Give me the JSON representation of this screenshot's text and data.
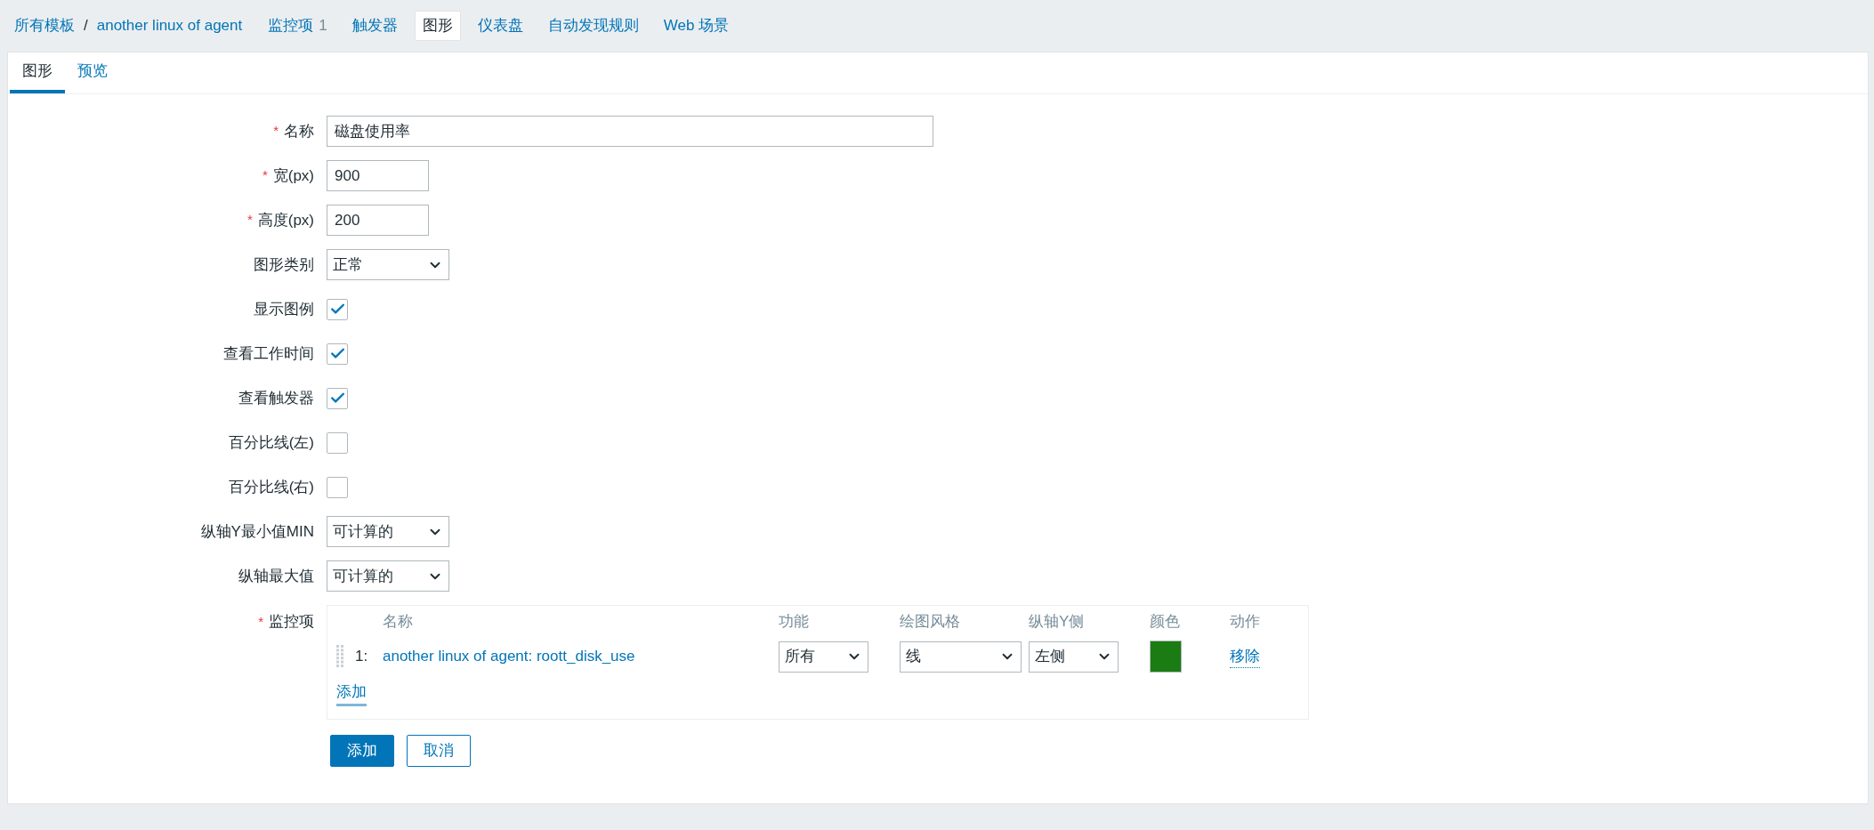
{
  "breadcrumb": {
    "items": [
      "所有模板",
      "another linux of agent"
    ],
    "separator": "/"
  },
  "nav_tabs": [
    {
      "label": "监控项",
      "count": "1",
      "selected": false
    },
    {
      "label": "触发器",
      "selected": false
    },
    {
      "label": "图形",
      "selected": true
    },
    {
      "label": "仪表盘",
      "selected": false
    },
    {
      "label": "自动发现规则",
      "selected": false
    },
    {
      "label": "Web 场景",
      "selected": false
    }
  ],
  "sub_tabs": [
    {
      "label": "图形",
      "selected": true
    },
    {
      "label": "预览",
      "selected": false
    }
  ],
  "form": [
    {
      "kind": "text",
      "label": "名称",
      "required_mark": "*",
      "value": "磁盘使用率"
    },
    {
      "kind": "number",
      "label": "宽(px)",
      "required_mark": "*",
      "value": "900"
    },
    {
      "kind": "number",
      "label": "高度(px)",
      "required_mark": "*",
      "value": "200"
    },
    {
      "kind": "select",
      "label": "图形类别",
      "value": "正常"
    },
    {
      "kind": "checkbox",
      "label": "显示图例",
      "checked": true
    },
    {
      "kind": "checkbox",
      "label": "查看工作时间",
      "checked": true
    },
    {
      "kind": "checkbox",
      "label": "查看触发器",
      "checked": true
    },
    {
      "kind": "checkbox",
      "label": "百分比线(左)",
      "checked": false
    },
    {
      "kind": "checkbox",
      "label": "百分比线(右)",
      "checked": false
    },
    {
      "kind": "select",
      "label": "纵轴Y最小值MIN",
      "value": "可计算的"
    },
    {
      "kind": "select",
      "label": "纵轴最大值",
      "value": "可计算的"
    }
  ],
  "items": {
    "label": "监控项",
    "required_mark": "*",
    "columns": [
      "名称",
      "功能",
      "绘图风格",
      "纵轴Y侧",
      "颜色",
      "动作"
    ],
    "rows": [
      {
        "index": "1:",
        "name": "another linux of agent: roott_disk_use",
        "function": "所有",
        "style": "线",
        "axis": "左侧",
        "color": "#1a7c12",
        "action": "移除"
      }
    ],
    "add_link": "添加"
  },
  "buttons": [
    {
      "label": "添加",
      "primary": true
    },
    {
      "label": "取消",
      "primary": false
    }
  ]
}
